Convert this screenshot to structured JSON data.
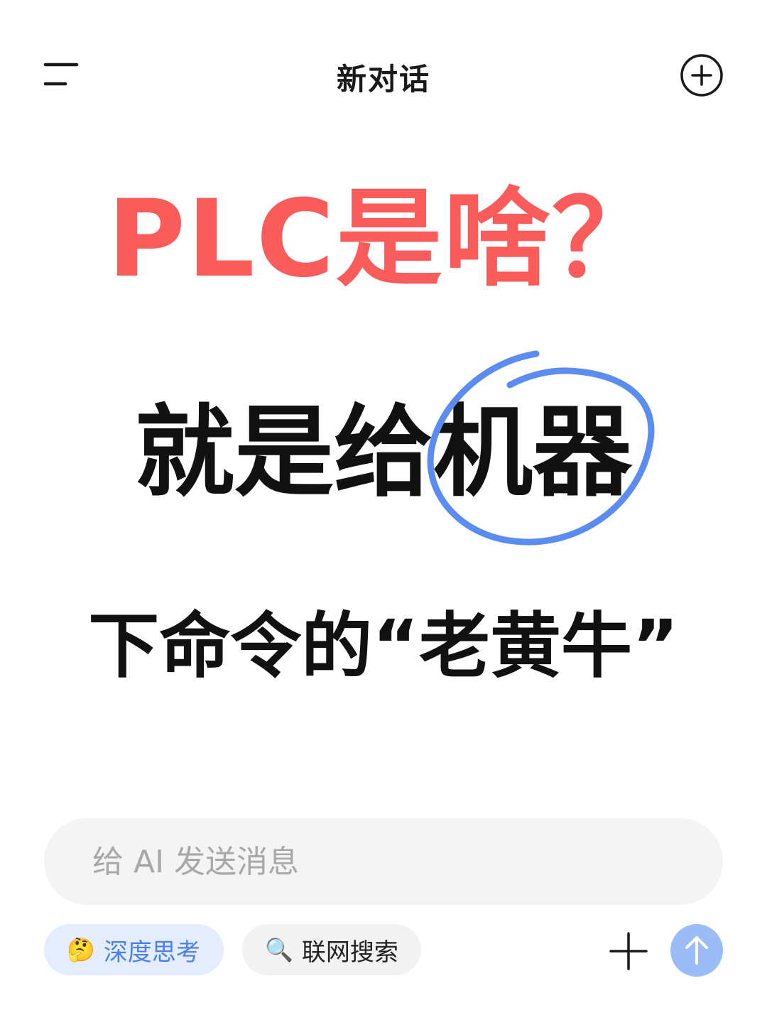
{
  "header": {
    "title": "新对话",
    "menu_icon": "hamburger-menu-icon",
    "new_chat_icon": "plus-circle-icon"
  },
  "content": {
    "headline": "PLC是啥？",
    "line2": "就是给机器",
    "line3": "下命令的“老黄牛”",
    "colors": {
      "headline": "#fa5b5b",
      "body": "#111111",
      "circle": "#5b8cf0"
    }
  },
  "composer": {
    "placeholder": "给 AI 发送消息",
    "chips": [
      {
        "label": "深度思考",
        "icon": "🤔"
      },
      {
        "label": "联网搜索",
        "icon": "🔍"
      }
    ],
    "attach_icon": "plus-icon",
    "send_icon": "arrow-up-icon",
    "send_color": "#9bbcf7"
  }
}
